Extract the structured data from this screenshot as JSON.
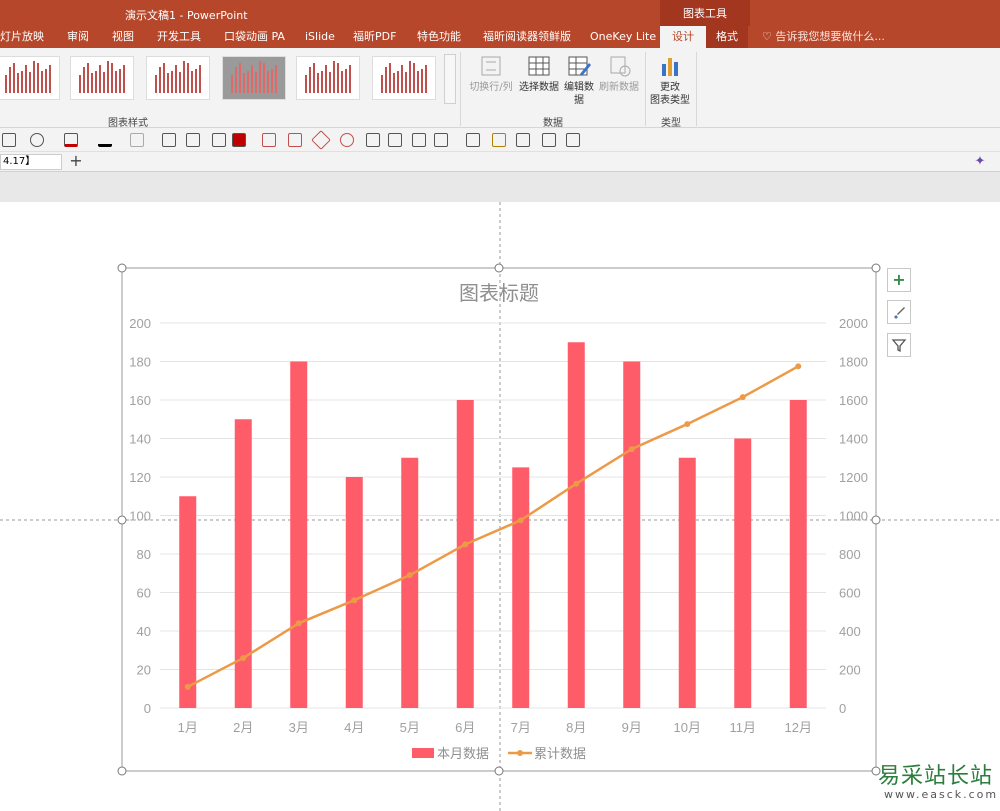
{
  "window": {
    "title": "演示文稿1 - PowerPoint",
    "tool_context": "图表工具"
  },
  "tabs": [
    {
      "label": "灯片放映"
    },
    {
      "label": "审阅"
    },
    {
      "label": "视图"
    },
    {
      "label": "开发工具"
    },
    {
      "label": "口袋动画 PA"
    },
    {
      "label": "iSlide"
    },
    {
      "label": "福昕PDF"
    },
    {
      "label": "特色功能"
    },
    {
      "label": "福昕阅读器领鲜版"
    },
    {
      "label": "OneKey Lite"
    },
    {
      "label": "设计"
    },
    {
      "label": "格式"
    }
  ],
  "tell_me": "告诉我您想要做什么...",
  "ribbon": {
    "chart_styles_label": "图表样式",
    "data_group_label": "数据",
    "type_group_label": "类型",
    "switch_row_col": "切换行/列",
    "select_data": "选择数据",
    "edit_data_1": "编辑数",
    "edit_data_2": "据",
    "refresh_data": "刷新数据",
    "change_type_1": "更改",
    "change_type_2": "图表类型"
  },
  "namebar": {
    "field_value": "4.17】"
  },
  "chart_data": {
    "type": "bar",
    "title": "图表标题",
    "categories": [
      "1月",
      "2月",
      "3月",
      "4月",
      "5月",
      "6月",
      "7月",
      "8月",
      "9月",
      "10月",
      "11月",
      "12月"
    ],
    "series": [
      {
        "name": "本月数据",
        "type": "bar",
        "axis": "left",
        "color": "#ff5c6a",
        "values": [
          110,
          150,
          180,
          120,
          130,
          160,
          125,
          190,
          180,
          130,
          140,
          160
        ]
      },
      {
        "name": "累计数据",
        "type": "line",
        "axis": "right",
        "color": "#ec9a48",
        "values": [
          110,
          260,
          440,
          560,
          690,
          850,
          975,
          1165,
          1345,
          1475,
          1615,
          1775
        ]
      }
    ],
    "y_left": {
      "min": 0,
      "max": 200,
      "step": 20,
      "ticks": [
        "0",
        "20",
        "40",
        "60",
        "80",
        "100",
        "120",
        "140",
        "160",
        "180",
        "200"
      ]
    },
    "y_right": {
      "min": 0,
      "max": 2000,
      "step": 200,
      "ticks": [
        "0",
        "200",
        "400",
        "600",
        "800",
        "1000",
        "1200",
        "1400",
        "1600",
        "1800",
        "2000"
      ]
    },
    "grid": true,
    "legend_position": "bottom"
  },
  "watermark": {
    "text": "易采站长站",
    "url": "www.easck.com"
  },
  "colors": {
    "accent": "#b7472a",
    "bar": "#ff5c6a",
    "line": "#ec9a48"
  }
}
